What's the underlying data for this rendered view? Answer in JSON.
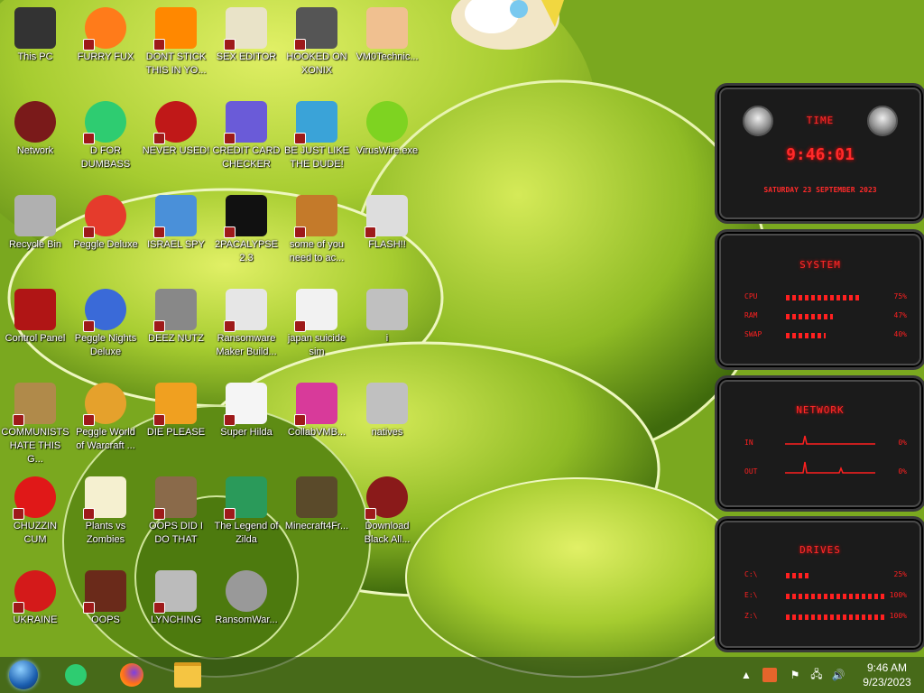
{
  "desktop": {
    "icons": [
      {
        "label": "This PC",
        "icon": "computer-icon"
      },
      {
        "label": "FURRY FUX",
        "icon": "firefox-icon"
      },
      {
        "label": "DONT STICK THIS IN YO...",
        "icon": "vlc-cone-icon"
      },
      {
        "label": "SEX EDITOR",
        "icon": "hxd-editor-icon"
      },
      {
        "label": "HOOKED ON XONIX",
        "icon": "xonix-game-icon"
      },
      {
        "label": "VM0Technic...",
        "icon": "doctor-icon"
      },
      {
        "label": "Network",
        "icon": "network-icon"
      },
      {
        "label": "D FOR DUMBASS",
        "icon": "chat-icon"
      },
      {
        "label": "NEVER USED!",
        "icon": "devcpp-icon"
      },
      {
        "label": "CREDIT CARD CHECKER",
        "icon": "credit-card-icon"
      },
      {
        "label": "BE JUST LIKE THE DUDE!",
        "icon": "santa-icon"
      },
      {
        "label": "VirusWire.exe",
        "icon": "lime-icon"
      },
      {
        "label": "Recycle Bin",
        "icon": "recycle-bin-icon"
      },
      {
        "label": "Peggle Deluxe",
        "icon": "peggle-icon"
      },
      {
        "label": "ISRAEL SPY",
        "icon": "network-spy-icon"
      },
      {
        "label": "2PACALYPSE 2.3",
        "icon": "terminal-icon"
      },
      {
        "label": "some of you need to ac...",
        "icon": "dog-icon"
      },
      {
        "label": "FLASH!!",
        "icon": "flash-file-icon"
      },
      {
        "label": "Control Panel",
        "icon": "control-panel-icon"
      },
      {
        "label": "Peggle Nights Deluxe",
        "icon": "peggle-nights-icon"
      },
      {
        "label": "DEEZ NUTZ",
        "icon": "stack-icon"
      },
      {
        "label": "Ransomware Maker Build...",
        "icon": "builder-window-icon"
      },
      {
        "label": "japan suicide sim",
        "icon": "japan-sim-icon"
      },
      {
        "label": "i",
        "icon": "file-icon"
      },
      {
        "label": "COMMUNISTS HATE THIS G...",
        "icon": "money-bag-icon"
      },
      {
        "label": "Peggle World of Warcraft ...",
        "icon": "peggle-wow-icon"
      },
      {
        "label": "DIE PLEASE",
        "icon": "de-icon"
      },
      {
        "label": "Super Hilda",
        "icon": "pixel-char-icon"
      },
      {
        "label": "CollabVMB...",
        "icon": "monitor-icon"
      },
      {
        "label": "natives",
        "icon": "file-icon"
      },
      {
        "label": "CHUZZIN CUM",
        "icon": "chuzzle-icon"
      },
      {
        "label": "Plants vs Zombies",
        "icon": "flower-icon"
      },
      {
        "label": "OOPS DID I DO THAT",
        "icon": "portrait-icon"
      },
      {
        "label": "The Legend of Zilda",
        "icon": "zilda-icon"
      },
      {
        "label": "Minecraft4Fr...",
        "icon": "minecraft-icon"
      },
      {
        "label": "Download Black All...",
        "icon": "red-orb-icon"
      },
      {
        "label": "UKRAINE",
        "icon": "radiation-icon"
      },
      {
        "label": "OOPS",
        "icon": "book-icon"
      },
      {
        "label": "LYNCHING",
        "icon": "rope-icon"
      },
      {
        "label": "RansomWar...",
        "icon": "skull-icon"
      }
    ]
  },
  "gadget": {
    "time": {
      "title": "TIME",
      "clock": "9:46:01",
      "date": "SATURDAY 23 SEPTEMBER 2023"
    },
    "system": {
      "title": "SYSTEM",
      "rows": [
        {
          "name": "CPU",
          "value": "75%",
          "level": 0.75
        },
        {
          "name": "RAM",
          "value": "47%",
          "level": 0.47
        },
        {
          "name": "SWAP",
          "value": "40%",
          "level": 0.4
        }
      ]
    },
    "network": {
      "title": "NETWORK",
      "rows": [
        {
          "name": "IN",
          "value": "0%"
        },
        {
          "name": "OUT",
          "value": "0%"
        }
      ]
    },
    "drives": {
      "title": "DRIVES",
      "rows": [
        {
          "name": "C:\\",
          "value": "25%",
          "level": 0.25
        },
        {
          "name": "E:\\",
          "value": "100%",
          "level": 1.0
        },
        {
          "name": "Z:\\",
          "value": "100%",
          "level": 1.0
        }
      ]
    }
  },
  "taskbar": {
    "pinned": [
      {
        "icon": "start-orb-icon"
      },
      {
        "icon": "chat-icon"
      },
      {
        "icon": "firefox-icon"
      },
      {
        "icon": "file-explorer-icon"
      }
    ],
    "tray": {
      "time": "9:46 AM",
      "date": "9/23/2023"
    }
  },
  "colors": {
    "accent": "#ff2020",
    "wallpaper": "#9dc52a",
    "taskbar": "#2a4a18"
  }
}
